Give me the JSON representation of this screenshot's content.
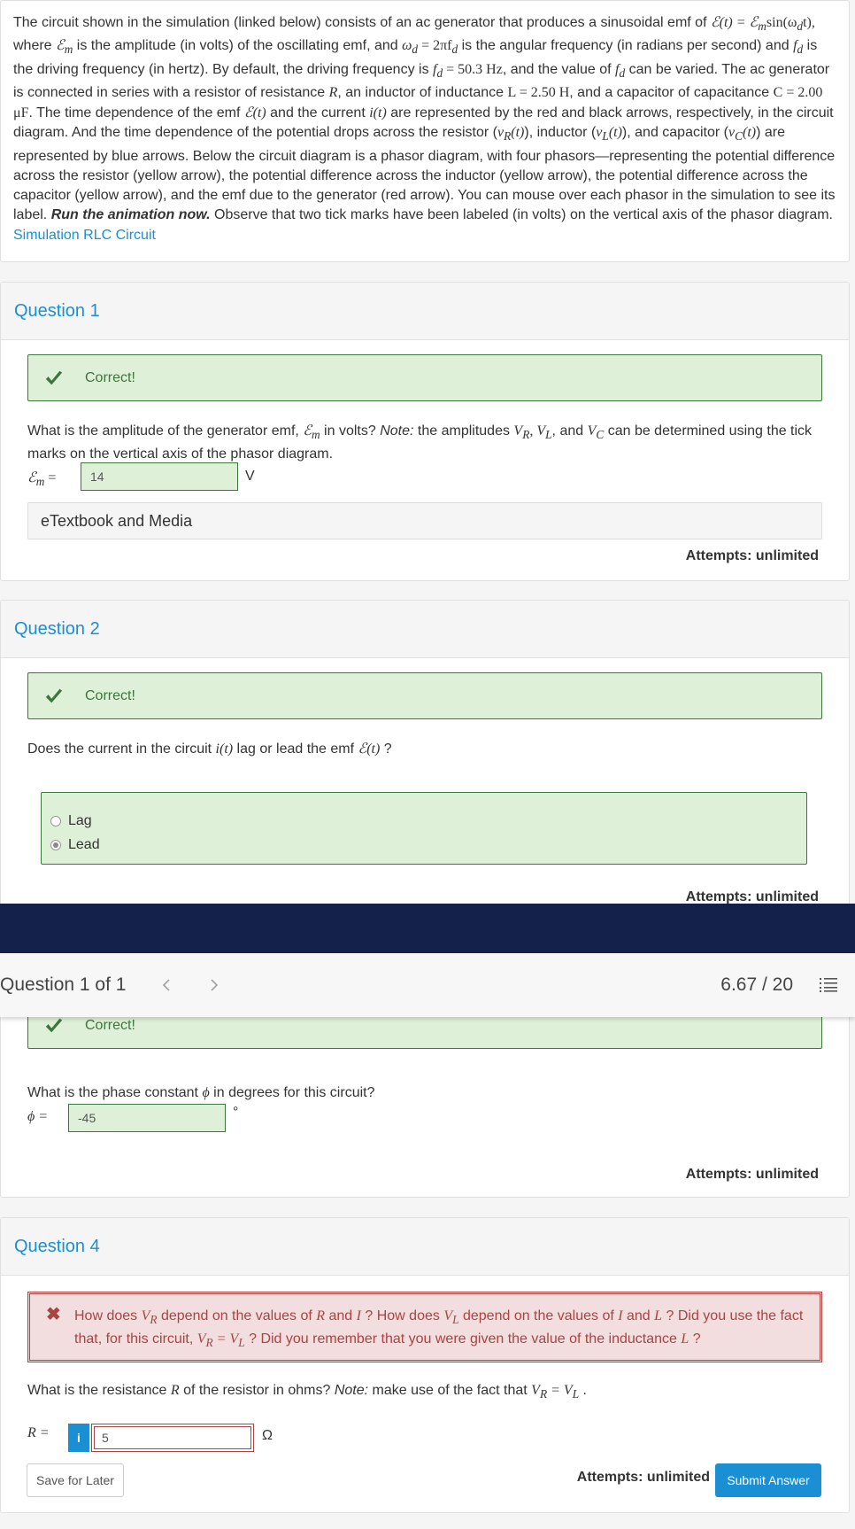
{
  "intro": {
    "p1": "The circuit shown in the simulation (linked below) consists of an ac generator that produces a sinusoidal emf of ",
    "p1_math": "ℰ(t) = ℰ",
    "p1_sub": "m",
    "p1_math2": "sin(ω",
    "p1_sub2": "d",
    "p1_math3": "t),",
    "p2a": " where ",
    "p2_math": "ℰ",
    "p2_sub": "m",
    "p2b": " is the amplitude (in volts) of the oscillating emf, and ",
    "p2_math2": "ω",
    "p2_sub2": "d",
    "p2_math3": " = 2πf",
    "p2_sub3": "d",
    "p2c": " is the angular frequency (in radians per second) and ",
    "p2_math4": "f",
    "p2_sub4": "d",
    "p2d": " is the driving frequency (in hertz). By default, the driving frequency is ",
    "p2_math5": "f",
    "p2_sub5": "d",
    "p2_math6": " = 50.3 Hz",
    "p2e": ", and the value of ",
    "p2_math7": "f",
    "p2_sub7": "d",
    "p2f": " can be varied. The ac generator is connected in series with a resistor of resistance ",
    "p2_R": "R",
    "p2g": ", an inductor of inductance ",
    "p2_L": "L = 2.50 H",
    "p2h": ", and a capacitor of capacitance ",
    "p2_C": "C = 2.00 μF",
    "p2i": ". The time dependence of the emf ",
    "p2_emf": "ℰ(t)",
    "p2j": " and the current ",
    "p2_it": "i(t)",
    "p2k": " are represented by the red and black arrows, respectively, in the circuit diagram. And the time dependence of the potential drops across the resistor (",
    "p2_vR": "v",
    "p2_vRs": "R",
    "p2_vRt": "(t)",
    "p2l": "), inductor (",
    "p2_vL": "v",
    "p2_vLs": "L",
    "p2_vLt": "(t)",
    "p2m": "), and capacitor (",
    "p2_vC": "v",
    "p2_vCs": "C",
    "p2_vCt": "(t)",
    "p2n": ") are represented by blue arrows. Below the circuit diagram is a phasor diagram, with four phasors—representing the potential difference across the resistor (yellow arrow), the potential difference across the inductor (yellow arrow), the potential difference across the capacitor (yellow arrow), and the emf due to the generator (red arrow). You can mouse over each phasor in the simulation to see its label. ",
    "p2_bold": "Run the animation now.",
    "p2o": " Observe that two tick marks have been labeled (in volts) on the vertical axis of the phasor diagram.",
    "link": "Simulation RLC Circuit"
  },
  "q1": {
    "title": "Question 1",
    "feedback": "Correct!",
    "text_a": "What is the amplitude of the generator emf, ",
    "text_math": "ℰ",
    "text_sub": "m",
    "text_b": " in volts? ",
    "text_note": "Note:",
    "text_c": " the amplitudes ",
    "text_V": "V",
    "text_Vs1": "R",
    "text_V2": ", V",
    "text_Vs2": "L",
    "text_d": ", and ",
    "text_V3": "V",
    "text_Vs3": "C",
    "text_e": " can be determined using the tick marks on the vertical axis of the phasor diagram.",
    "label": "ℰ",
    "label_sub": "m",
    "label_eq": " =",
    "value": "14",
    "unit": "V",
    "etextbook": "eTextbook and Media",
    "attempts": "Attempts: unlimited"
  },
  "q2": {
    "title": "Question 2",
    "feedback": "Correct!",
    "text_a": "Does the current in the circuit ",
    "text_math": "i(t)",
    "text_b": " lag or lead the emf ",
    "text_math2": "ℰ(t)",
    "text_c": " ?",
    "options": [
      "Lag",
      "Lead"
    ],
    "selected": "Lead",
    "attempts": "Attempts: unlimited"
  },
  "nav": {
    "question_label": "Question 1 of 1",
    "score": "6.67 / 20"
  },
  "q3": {
    "feedback": "Correct!",
    "text_a": "What is the phase constant ",
    "text_math": "ϕ",
    "text_b": " in degrees for this circuit?",
    "label": "ϕ =",
    "value": "-45",
    "unit": "°",
    "attempts": "Attempts: unlimited"
  },
  "q4": {
    "title": "Question 4",
    "fb_a": "How does ",
    "fb_V": "V",
    "fb_Vs": "R",
    "fb_b": " depend on the values of ",
    "fb_R": "R",
    "fb_c": " and ",
    "fb_I": "I",
    "fb_d": " ? How does ",
    "fb_V2": "V",
    "fb_V2s": "L",
    "fb_e": " depend on the values of ",
    "fb_I2": "I",
    "fb_f": " and ",
    "fb_L": "L",
    "fb_g": " ? Did you use the fact that, for this circuit, ",
    "fb_V3": "V",
    "fb_V3s": "R",
    "fb_eq": " = V",
    "fb_V4s": "L",
    "fb_h": " ? Did you remember that you were given the value of the inductance ",
    "fb_L2": "L",
    "fb_i": " ?",
    "text_a": "What is the resistance ",
    "text_R": "R",
    "text_b": " of the resistor in ohms? ",
    "text_note": "Note:",
    "text_c": " make use of the fact that ",
    "text_V": "V",
    "text_Vs": "R",
    "text_eq": " = V",
    "text_V2s": "L",
    "text_d": " .",
    "label": "R =",
    "info": "i",
    "value": "5",
    "unit": "Ω",
    "save": "Save for Later",
    "attempts": "Attempts: unlimited",
    "submit": "Submit Answer"
  }
}
